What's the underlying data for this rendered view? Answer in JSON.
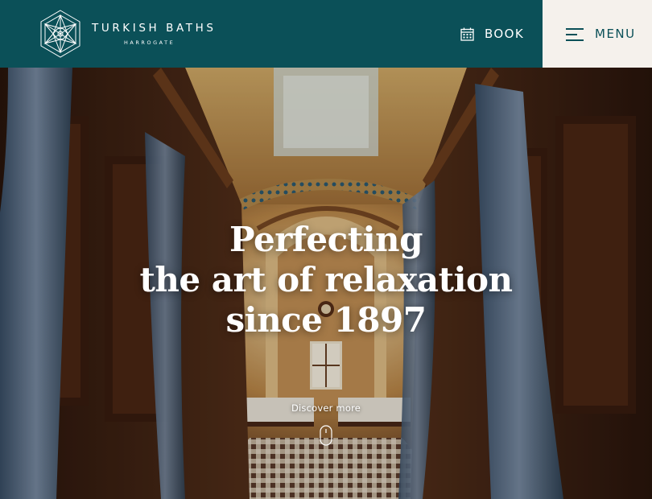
{
  "header": {
    "logo_title": "TURKISH BATHS",
    "logo_subtitle": "HARROGATE",
    "logo_icon": "geometric-star-icon",
    "book_label": "BOOK",
    "book_icon": "calendar-icon",
    "menu_label": "MENU",
    "menu_icon": "hamburger-icon"
  },
  "hero": {
    "headline_line1": "Perfecting",
    "headline_line2": "the art of relaxation",
    "headline_line3": "since 1897",
    "discover_label": "Discover more",
    "scroll_icon": "mouse-scroll-icon"
  },
  "colors": {
    "header_bg": "#0b5058",
    "menu_bg": "#f5f1ec",
    "menu_text": "#0b5058",
    "text_light": "#ffffff"
  }
}
